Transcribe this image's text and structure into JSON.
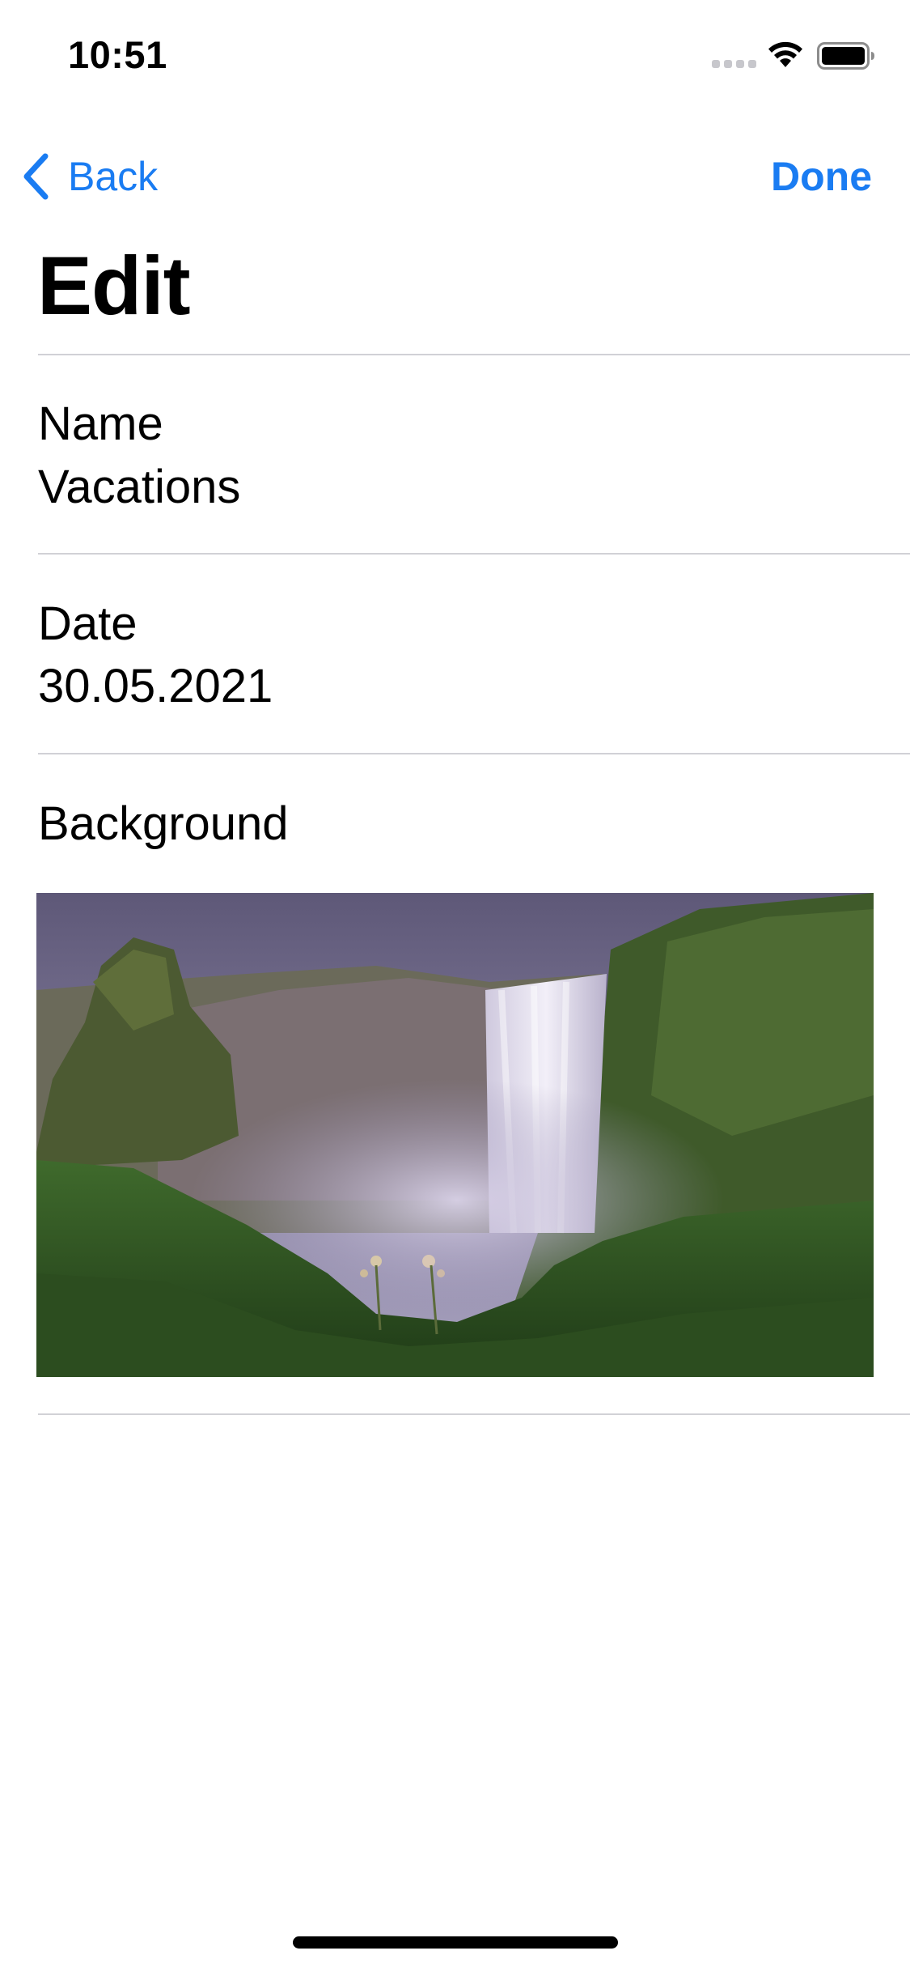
{
  "status_bar": {
    "time": "10:51",
    "icons": [
      "signal-dots-icon",
      "wifi-icon",
      "battery-icon"
    ]
  },
  "nav": {
    "back_label": "Back",
    "done_label": "Done",
    "accent_color": "#1a7cf2"
  },
  "page": {
    "title": "Edit"
  },
  "fields": {
    "name": {
      "label": "Name",
      "value": "Vacations"
    },
    "date": {
      "label": "Date",
      "value": "30.05.2021"
    },
    "background": {
      "label": "Background"
    }
  }
}
